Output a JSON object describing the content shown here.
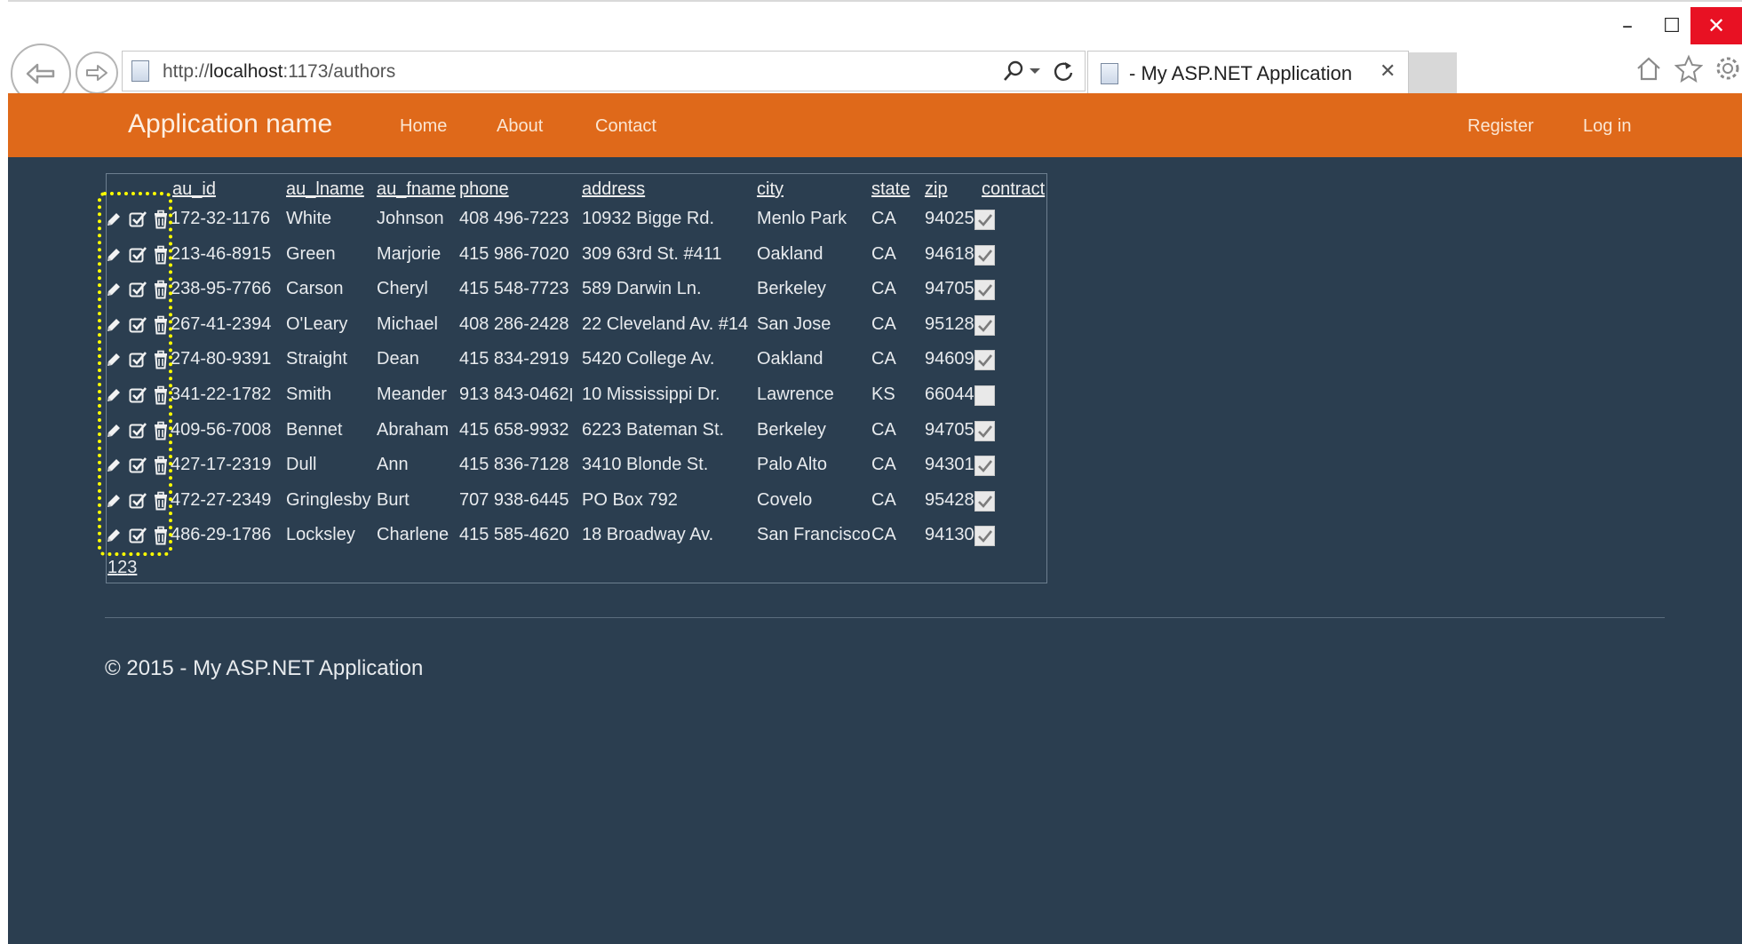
{
  "browser": {
    "url_prefix": "http://",
    "url_host": "localhost",
    "url_rest": ":1173/authors",
    "tab_title": "- My ASP.NET Application",
    "tab_close": "✕",
    "window_buttons": {
      "minimize": "–",
      "maximize": "☐",
      "close": "✕"
    }
  },
  "navbar": {
    "brand": "Application name",
    "links": [
      "Home",
      "About",
      "Contact"
    ],
    "right_links": [
      "Register",
      "Log in"
    ]
  },
  "grid": {
    "columns": [
      "au_id",
      "au_lname",
      "au_fname",
      "phone",
      "address",
      "city",
      "state",
      "zip",
      "contract"
    ],
    "rows": [
      {
        "au_id": "172-32-1176",
        "au_lname": "White",
        "au_fname": "Johnson",
        "phone": "408 496-7223",
        "address": "10932 Bigge Rd.",
        "city": "Menlo Park",
        "state": "CA",
        "zip": "94025",
        "contract": true
      },
      {
        "au_id": "213-46-8915",
        "au_lname": "Green",
        "au_fname": "Marjorie",
        "phone": "415 986-7020",
        "address": "309 63rd St. #411",
        "city": "Oakland",
        "state": "CA",
        "zip": "94618",
        "contract": true
      },
      {
        "au_id": "238-95-7766",
        "au_lname": "Carson",
        "au_fname": "Cheryl",
        "phone": "415 548-7723",
        "address": "589 Darwin Ln.",
        "city": "Berkeley",
        "state": "CA",
        "zip": "94705",
        "contract": true
      },
      {
        "au_id": "267-41-2394",
        "au_lname": "O'Leary",
        "au_fname": "Michael",
        "phone": "408 286-2428",
        "address": "22 Cleveland Av. #14",
        "city": "San Jose",
        "state": "CA",
        "zip": "95128",
        "contract": true
      },
      {
        "au_id": "274-80-9391",
        "au_lname": "Straight",
        "au_fname": "Dean",
        "phone": "415 834-2919",
        "address": "5420 College Av.",
        "city": "Oakland",
        "state": "CA",
        "zip": "94609",
        "contract": true
      },
      {
        "au_id": "341-22-1782",
        "au_lname": "Smith",
        "au_fname": "Meander",
        "phone": "913 843-0462",
        "address": "10 Mississippi Dr.",
        "city": "Lawrence",
        "state": "KS",
        "zip": "66044",
        "contract": false
      },
      {
        "au_id": "409-56-7008",
        "au_lname": "Bennet",
        "au_fname": "Abraham",
        "phone": "415 658-9932",
        "address": "6223 Bateman St.",
        "city": "Berkeley",
        "state": "CA",
        "zip": "94705",
        "contract": true
      },
      {
        "au_id": "427-17-2319",
        "au_lname": "Dull",
        "au_fname": "Ann",
        "phone": "415 836-7128",
        "address": "3410 Blonde St.",
        "city": "Palo Alto",
        "state": "CA",
        "zip": "94301",
        "contract": true
      },
      {
        "au_id": "472-27-2349",
        "au_lname": "Gringlesby",
        "au_fname": "Burt",
        "phone": "707 938-6445",
        "address": "PO Box 792",
        "city": "Covelo",
        "state": "CA",
        "zip": "95428",
        "contract": true
      },
      {
        "au_id": "486-29-1786",
        "au_lname": "Locksley",
        "au_fname": "Charlene",
        "phone": "415 585-4620",
        "address": "18 Broadway Av.",
        "city": "San Francisco",
        "state": "CA",
        "zip": "94130",
        "contract": true
      }
    ],
    "pager": [
      "1",
      "2",
      "3"
    ]
  },
  "footer": {
    "text": "© 2015 - My ASP.NET Application"
  },
  "colors": {
    "navbar": "#df691a",
    "page_bg": "#2b3e50",
    "highlight": "#ffff00",
    "close_button": "#e81123"
  },
  "icons": {
    "row_actions": [
      "pencil-icon",
      "check-square-icon",
      "trash-icon"
    ],
    "browser": [
      "back-icon",
      "forward-icon",
      "search-icon",
      "refresh-icon",
      "home-icon",
      "star-icon",
      "gear-icon"
    ]
  }
}
